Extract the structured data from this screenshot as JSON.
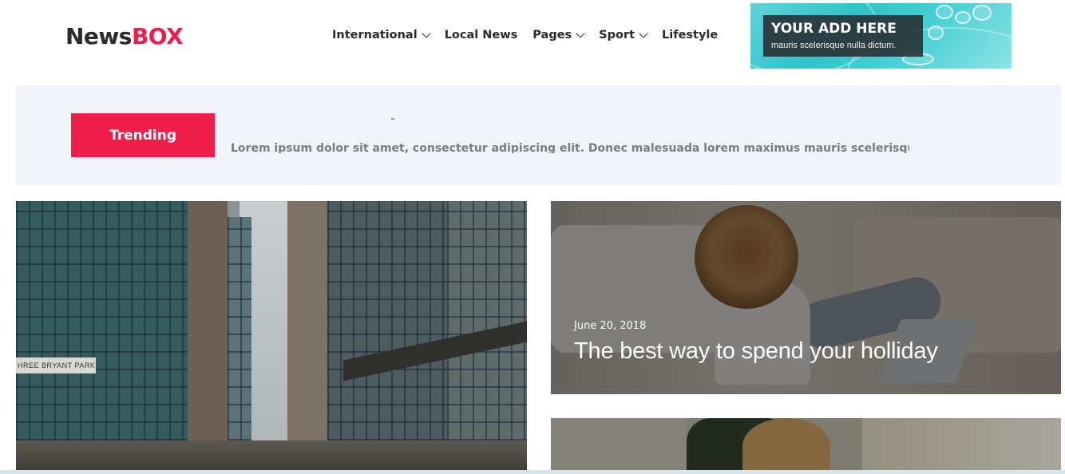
{
  "header": {
    "logo": {
      "part1": "News",
      "part2": "BOX"
    },
    "nav": [
      {
        "label": "International",
        "has_dropdown": true
      },
      {
        "label": "Local News",
        "has_dropdown": false
      },
      {
        "label": "Pages",
        "has_dropdown": true
      },
      {
        "label": "Sport",
        "has_dropdown": true
      },
      {
        "label": "Lifestyle",
        "has_dropdown": false
      }
    ],
    "ad": {
      "title": "YOUR ADD HERE",
      "subtitle": "mauris scelerisque nulla dictum."
    }
  },
  "trending": {
    "label": "Trending",
    "ticker": "Lorem ipsum dolor sit amet, consectetur adipiscing elit. Donec malesuada lorem maximus mauris scelerisque"
  },
  "featured_left": {
    "image_alt": "city-street",
    "sign_text": "HREE BRYANT PARK"
  },
  "articles": [
    {
      "date": "June 20, 2018",
      "title": "The best way to spend your holliday"
    }
  ],
  "colors": {
    "brand_red": "#ee1d4a",
    "dark_text": "#2b2b2b",
    "trending_bg": "#f0f3f7"
  }
}
